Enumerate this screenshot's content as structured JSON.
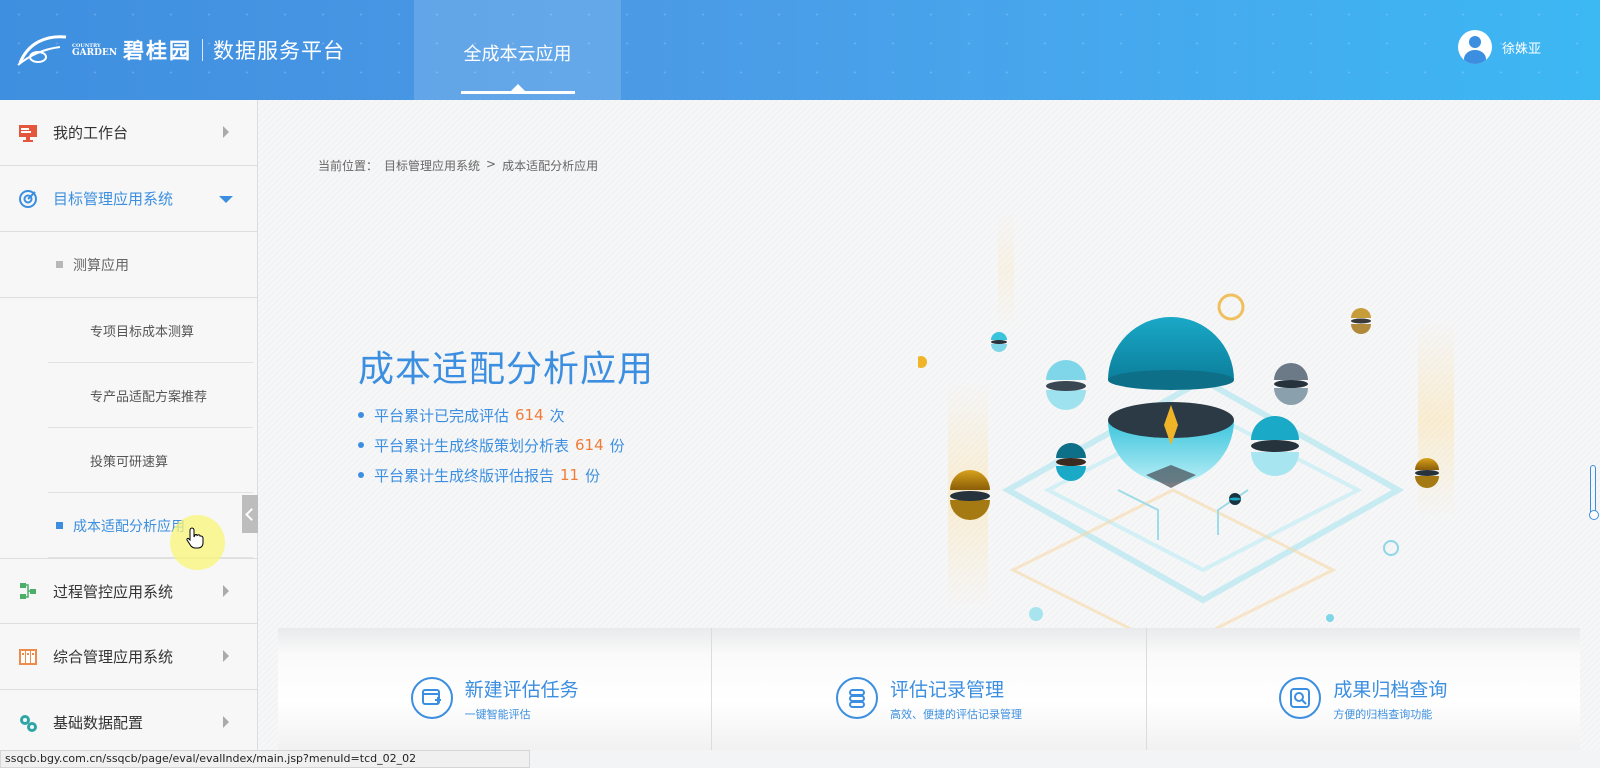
{
  "header": {
    "brand_top": "COUNTRY",
    "brand_garden": "GARDEN",
    "brand_cn": "碧桂园",
    "platform": "数据服务平台",
    "nav_tab": "全成本云应用",
    "user_name": "徐姝亚"
  },
  "sidebar": {
    "items": [
      {
        "label": "我的工作台"
      },
      {
        "label": "目标管理应用系统"
      },
      {
        "label": "测算应用"
      },
      {
        "label": "专项目标成本测算"
      },
      {
        "label": "专产品适配方案推荐"
      },
      {
        "label": "投策可研速算"
      },
      {
        "label": "成本适配分析应用"
      },
      {
        "label": "过程管控应用系统"
      },
      {
        "label": "综合管理应用系统"
      },
      {
        "label": "基础数据配置"
      }
    ]
  },
  "breadcrumb": {
    "prefix": "当前位置：",
    "level1": "目标管理应用系统",
    "sep": ">",
    "level2": "成本适配分析应用"
  },
  "hero": {
    "title": "成本适配分析应用",
    "stats": [
      {
        "pre": "平台累计已完成评估",
        "num": "614",
        "unit": "次"
      },
      {
        "pre": "平台累计生成终版策划分析表",
        "num": "614",
        "unit": "份"
      },
      {
        "pre": "平台累计生成终版评估报告",
        "num": "11",
        "unit": "份"
      }
    ]
  },
  "cards": [
    {
      "title": "新建评估任务",
      "sub": "一键智能评估"
    },
    {
      "title": "评估记录管理",
      "sub": "高效、便捷的评估记录管理"
    },
    {
      "title": "成果归档查询",
      "sub": "方便的归档查询功能"
    }
  ],
  "status_url": "ssqcb.bgy.com.cn/ssqcb/page/eval/evalIndex/main.jsp?menuId=tcd_02_02",
  "colors": {
    "accent": "#3c8fe0",
    "number": "#f07c3a",
    "header": "#4b9ae6"
  }
}
